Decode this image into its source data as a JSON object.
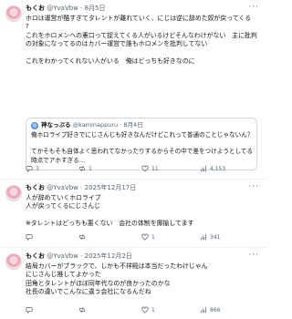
{
  "posts": [
    {
      "name": "もくお",
      "handle": "@YvaVbw",
      "sep": "·",
      "date": "8月5日",
      "more": "···",
      "text": "ホロは運営が酷すぎてタレントが離れていく、にじは逆に辞めた奴が戻ってくる\n?\nこれをホロメンへの憲口って捉えてくる人がいるけどそんなわけがない　主に批判の対象になってるのはカバー運営で誰もホロメンを批判してない\n\nこれをわかってくれない人がいる　俺はどっちも好きなのに",
      "quote": {
        "name": "神なっぷる",
        "handle": "@kaminappuru",
        "sep": "·",
        "date": "8月4日",
        "text": "俺ホロライブ好きでにじさんじも好きなんだけどこれって普通のことじゃないん？\n\nてかそもそも自体よく思われてなかったりするからその中で差をつけようとしてる時点でアホすぎる…"
      },
      "stats": {
        "replies": "3",
        "reposts": "1",
        "likes": "11",
        "views": "4,153"
      }
    },
    {
      "name": "もくお",
      "handle": "@YvaVbw",
      "sep": "·",
      "date": "2025年12月17日",
      "more": "···",
      "text": "人が辞めていくホロライブ\n人が戻ってくるにじさんじ\n\n※タレントはどっちも悪くない　会社の体制を揶揄してます",
      "stats": {
        "replies": "",
        "reposts": "",
        "likes": "1",
        "views": "341"
      }
    },
    {
      "name": "もくお",
      "handle": "@YvaVbw",
      "sep": "·",
      "date": "2025年12月2日",
      "more": "···",
      "text": "結局カバーがブラックで、しかも不祥殿は本当だったわけじゃん\nにじさんじ推してよかった\n田角とタレントがほぼ同年代なのが良かったのかな\n社長の違いでこんなに違う会社になるんだね",
      "stats": {
        "replies": "",
        "reposts": "",
        "likes": "1",
        "views": "866"
      }
    }
  ]
}
